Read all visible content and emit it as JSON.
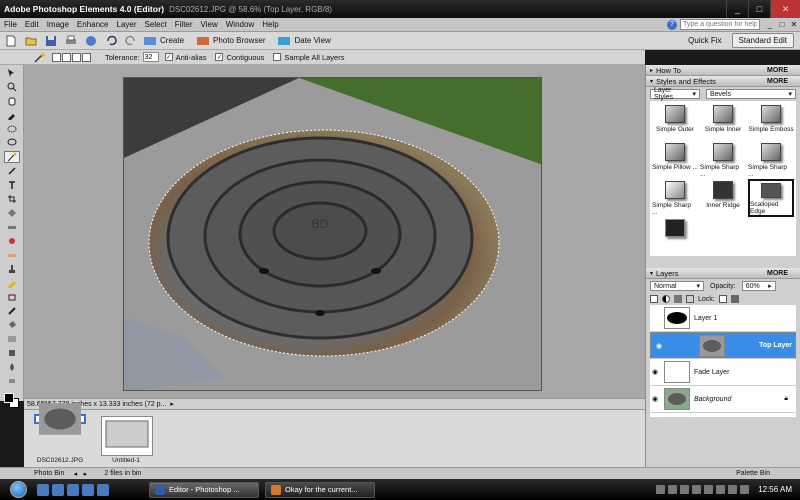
{
  "window": {
    "app_title": "Adobe Photoshop Elements 4.0 (Editor)",
    "doc_title": "DSC02612.JPG @ 58.6% (Top Layer, RGB/8)",
    "minimize": "_",
    "maximize": "□",
    "close": "✕"
  },
  "menu": {
    "items": [
      "File",
      "Edit",
      "Image",
      "Enhance",
      "Layer",
      "Select",
      "Filter",
      "View",
      "Window",
      "Help"
    ],
    "help_placeholder": "Type a question for help",
    "mdi_min": "_",
    "mdi_restore": "□",
    "mdi_close": "✕"
  },
  "shortcuts": {
    "create": "Create",
    "photo_browser": "Photo Browser",
    "date_view": "Date View",
    "quick_fix": "Quick Fix",
    "standard_edit": "Standard Edit"
  },
  "options": {
    "tolerance_label": "Tolerance:",
    "tolerance_value": "32",
    "anti_alias": "Anti-alias",
    "contiguous": "Contiguous",
    "sample_all_layers": "Sample All Layers",
    "anti_alias_checked": true,
    "contiguous_checked": true,
    "sample_all_checked": false
  },
  "status": {
    "zoom": "58.65%",
    "info": "17.778 inches x 13.333 inches (72 p...",
    "arrow": "▸"
  },
  "photobin": {
    "items": [
      {
        "label": "DSC02612.JPG"
      },
      {
        "label": "Untitled-1"
      }
    ]
  },
  "binbar": {
    "photo_bin": "Photo Bin",
    "files": "2 files in bin",
    "palette_bin": "Palette Bin",
    "prev": "◂",
    "next": "▸"
  },
  "palette": {
    "how_to": "How To",
    "styles_effects": "Styles and Effects",
    "more": "MORE",
    "layer_styles": "Layer Styles",
    "bevels": "Bevels",
    "styles": [
      {
        "label": "Simple Outer"
      },
      {
        "label": "Simple Inner"
      },
      {
        "label": "Simple Emboss"
      },
      {
        "label": "Simple Pillow ..."
      },
      {
        "label": "Simple Sharp ..."
      },
      {
        "label": "Simple Sharp ..."
      },
      {
        "label": "Simple Sharp ..."
      },
      {
        "label": "Inner Ridge"
      },
      {
        "label": "Scalloped Edge"
      },
      {
        "label": ""
      }
    ],
    "layers_title": "Layers",
    "blend_mode": "Normal",
    "opacity_label": "Opacity:",
    "opacity_value": "60%",
    "lock_label": "Lock:",
    "layers": [
      {
        "name": "Layer 1",
        "visible": false,
        "selected": false,
        "italic": false
      },
      {
        "name": "Top Layer",
        "visible": true,
        "selected": true,
        "italic": false
      },
      {
        "name": "Fade Layer",
        "visible": true,
        "selected": false,
        "italic": false
      },
      {
        "name": "Background",
        "visible": true,
        "selected": false,
        "italic": true
      }
    ]
  },
  "taskbar": {
    "tasks": [
      {
        "label": "Editor - Photoshop ..."
      },
      {
        "label": "Okay for the current..."
      }
    ],
    "clock": "12:56 AM"
  },
  "colors": {
    "selection_blue": "#3a8de6",
    "grass": "#3f6b2a",
    "concrete": "#a9a9a9",
    "cover": "#585858"
  }
}
